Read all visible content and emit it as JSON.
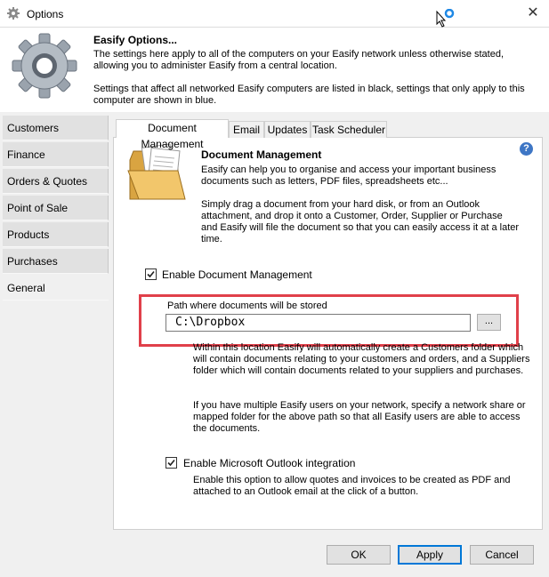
{
  "window": {
    "title": "Options",
    "close_glyph": "✕"
  },
  "header": {
    "title": "Easify Options...",
    "line1": "The settings here apply to all of the computers on your Easify network unless otherwise stated, allowing you to administer Easify from a central location.",
    "line2": "Settings that affect all networked Easify computers are listed in black, settings that only apply to this computer are shown in blue."
  },
  "sidebar": {
    "items": [
      {
        "label": "Customers"
      },
      {
        "label": "Finance"
      },
      {
        "label": "Orders & Quotes"
      },
      {
        "label": "Point of Sale"
      },
      {
        "label": "Products"
      },
      {
        "label": "Purchases"
      },
      {
        "label": "General",
        "selected": true
      }
    ]
  },
  "tabs": [
    {
      "label": "Document Management",
      "selected": true
    },
    {
      "label": "Email"
    },
    {
      "label": "Updates"
    },
    {
      "label": "Task Scheduler"
    }
  ],
  "content": {
    "title": "Document Management",
    "help_glyph": "?",
    "para1": "Easify can help you to organise and access your important business documents such as letters, PDF files, spreadsheets etc...",
    "para2": "Simply drag a document from your hard disk, or from an Outlook attachment, and drop it onto a Customer, Order, Supplier or Purchase and Easify will file the document so that you can easily access it at a later time.",
    "enable_doc_mgmt": {
      "label": "Enable Document Management",
      "checked": true
    },
    "path_label": "Path where documents will be stored",
    "path_value": "C:\\Dropbox",
    "browse_label": "...",
    "info1": "Within this location Easify will automatically create a Customers folder which will contain documents relating to your customers and orders, and a Suppliers folder which will contain documents related to your suppliers and purchases.",
    "info2": "If you have multiple Easify users on your network, specify a network share or mapped folder for the above path so that all Easify users are able to access the documents.",
    "enable_outlook": {
      "label": "Enable Microsoft Outlook integration",
      "checked": true
    },
    "outlook_desc": "Enable this option to allow quotes and invoices to be created as PDF and attached to an Outlook email at the click of a button."
  },
  "footer": {
    "ok_label": "OK",
    "apply_label": "Apply",
    "cancel_label": "Cancel"
  },
  "colors": {
    "highlight": "#e0404a",
    "help": "#3e76c5",
    "default_button": "#0078d7"
  },
  "icons": [
    "gear-icon",
    "folder-icon",
    "help-icon",
    "close-icon",
    "checkmark-icon",
    "cursor-icon"
  ]
}
